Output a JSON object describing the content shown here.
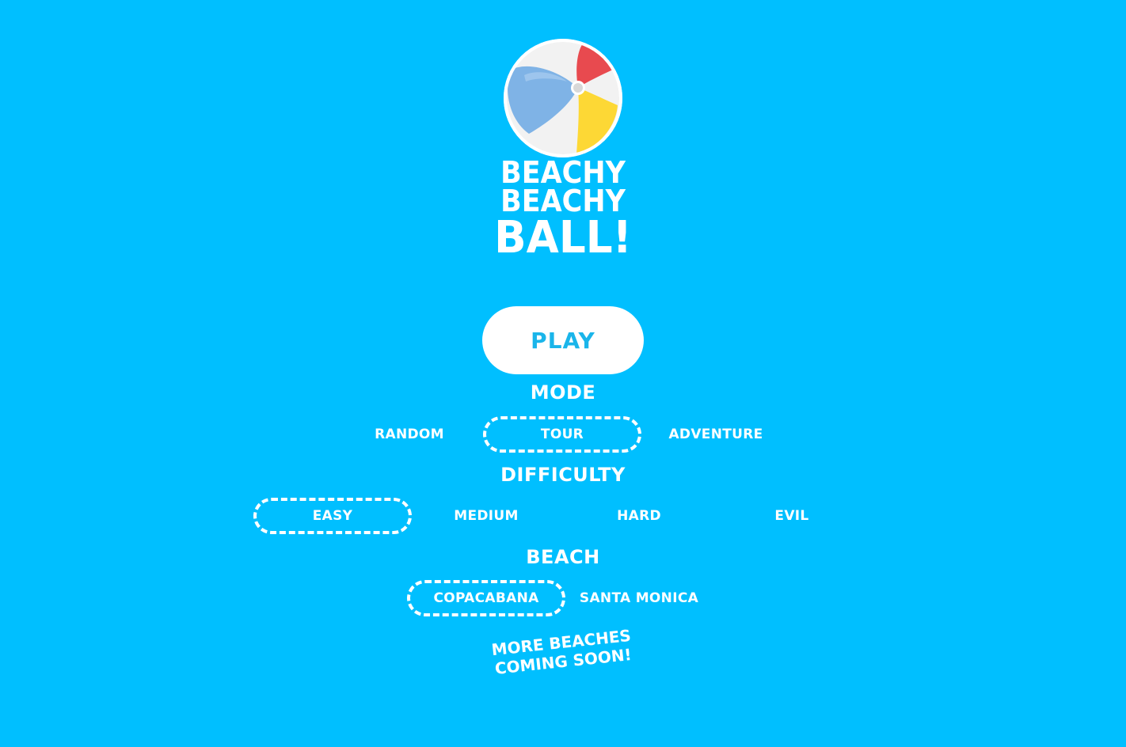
{
  "title": {
    "line1": "BEACHY",
    "line2": "BEACHY",
    "line3": "BALL!"
  },
  "play_button": {
    "label": "PLAY"
  },
  "mode": {
    "heading": "MODE",
    "options": [
      "RANDOM",
      "TOUR",
      "ADVENTURE"
    ],
    "selected": "TOUR"
  },
  "difficulty": {
    "heading": "DIFFICULTY",
    "options": [
      "EASY",
      "MEDIUM",
      "HARD",
      "EVIL"
    ],
    "selected": "EASY"
  },
  "beach": {
    "heading": "BEACH",
    "options": [
      "COPACABANA",
      "SANTA MONICA"
    ],
    "selected": "COPACABANA"
  },
  "coming_soon": {
    "line1": "MORE BEACHES",
    "line2": "COMING SOON!"
  },
  "colors": {
    "background": "#00bfff",
    "button_text": "#1ab5ea",
    "ball_red": "#e84a4f",
    "ball_yellow": "#fdd835",
    "ball_blue": "#7fb3e6",
    "ball_white": "#f2f2f2"
  }
}
